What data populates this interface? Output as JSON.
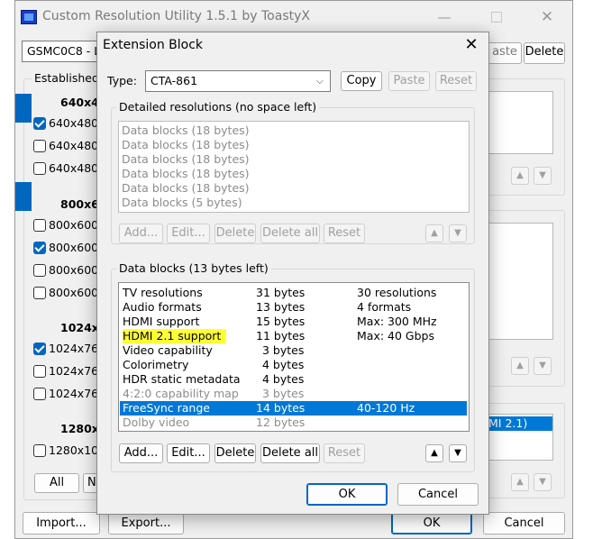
{
  "main": {
    "title": "Custom Resolution Utility 1.5.1 by ToastyX",
    "controls": {
      "minimize": "—",
      "maximize": "",
      "close": "✕"
    },
    "monitor_select": "GSMC0C8 - L",
    "top_buttons": {
      "paste": "aste",
      "delete": "Delete"
    },
    "established_label": "Established",
    "groups": [
      {
        "header": "640x48",
        "items": [
          {
            "label": "640x480",
            "checked": true
          },
          {
            "label": "640x480",
            "checked": false
          },
          {
            "label": "640x480",
            "checked": false
          }
        ]
      },
      {
        "header": "800x60",
        "items": [
          {
            "label": "800x600",
            "checked": false
          },
          {
            "label": "800x600",
            "checked": true
          },
          {
            "label": "800x600",
            "checked": false
          },
          {
            "label": "800x600",
            "checked": false
          }
        ]
      },
      {
        "header": "1024x7",
        "items": [
          {
            "label": "1024x76",
            "checked": true
          },
          {
            "label": "1024x76",
            "checked": false
          },
          {
            "label": "1024x76",
            "checked": false
          }
        ]
      },
      {
        "header": "1280x1",
        "items": [
          {
            "label": "1280x10",
            "checked": false
          }
        ]
      }
    ],
    "all_button": "All",
    "none_button": "N",
    "right_list_selected": "MI 2.1)",
    "arrows": {
      "up": "▲",
      "down": "▼"
    },
    "bottom": {
      "import": "Import...",
      "export": "Export...",
      "ok": "OK",
      "cancel": "Cancel"
    }
  },
  "dialog": {
    "title": "Extension Block",
    "close": "✕",
    "type_label": "Type:",
    "type_value": "CTA-861",
    "type_buttons": {
      "copy": "Copy",
      "paste": "Paste",
      "reset": "Reset"
    },
    "detailed": {
      "label": "Detailed resolutions (no space left)",
      "items": [
        "Data blocks (18 bytes)",
        "Data blocks (18 bytes)",
        "Data blocks (18 bytes)",
        "Data blocks (18 bytes)",
        "Data blocks (18 bytes)",
        "Data blocks (5 bytes)"
      ],
      "buttons": {
        "add": "Add...",
        "edit": "Edit...",
        "delete": "Delete",
        "delete_all": "Delete all",
        "reset": "Reset"
      }
    },
    "data_blocks": {
      "label": "Data blocks (13 bytes left)",
      "rows": [
        {
          "name": "TV resolutions",
          "size": "31 bytes",
          "info": "30 resolutions",
          "state": "normal"
        },
        {
          "name": "Audio formats",
          "size": "13 bytes",
          "info": "4 formats",
          "state": "normal"
        },
        {
          "name": "HDMI support",
          "size": "15 bytes",
          "info": "Max: 300 MHz",
          "state": "normal"
        },
        {
          "name": "HDMI 2.1 support",
          "size": "11 bytes",
          "info": "Max: 40 Gbps",
          "state": "highlight"
        },
        {
          "name": "Video capability",
          "size": "3 bytes",
          "info": "",
          "state": "normal"
        },
        {
          "name": "Colorimetry",
          "size": "4 bytes",
          "info": "",
          "state": "normal"
        },
        {
          "name": "HDR static metadata",
          "size": "4 bytes",
          "info": "",
          "state": "normal"
        },
        {
          "name": "4:2:0 capability map",
          "size": "3 bytes",
          "info": "",
          "state": "grey"
        },
        {
          "name": "FreeSync range",
          "size": "14 bytes",
          "info": "40-120 Hz",
          "state": "selected"
        },
        {
          "name": "Dolby video",
          "size": "12 bytes",
          "info": "",
          "state": "grey"
        }
      ],
      "buttons": {
        "add": "Add...",
        "edit": "Edit...",
        "delete": "Delete",
        "delete_all": "Delete all",
        "reset": "Reset"
      }
    },
    "ok": "OK",
    "cancel": "Cancel"
  },
  "colors": {
    "accent": "#0067c0",
    "selection": "#0078d7",
    "highlight": "#ffff33"
  }
}
